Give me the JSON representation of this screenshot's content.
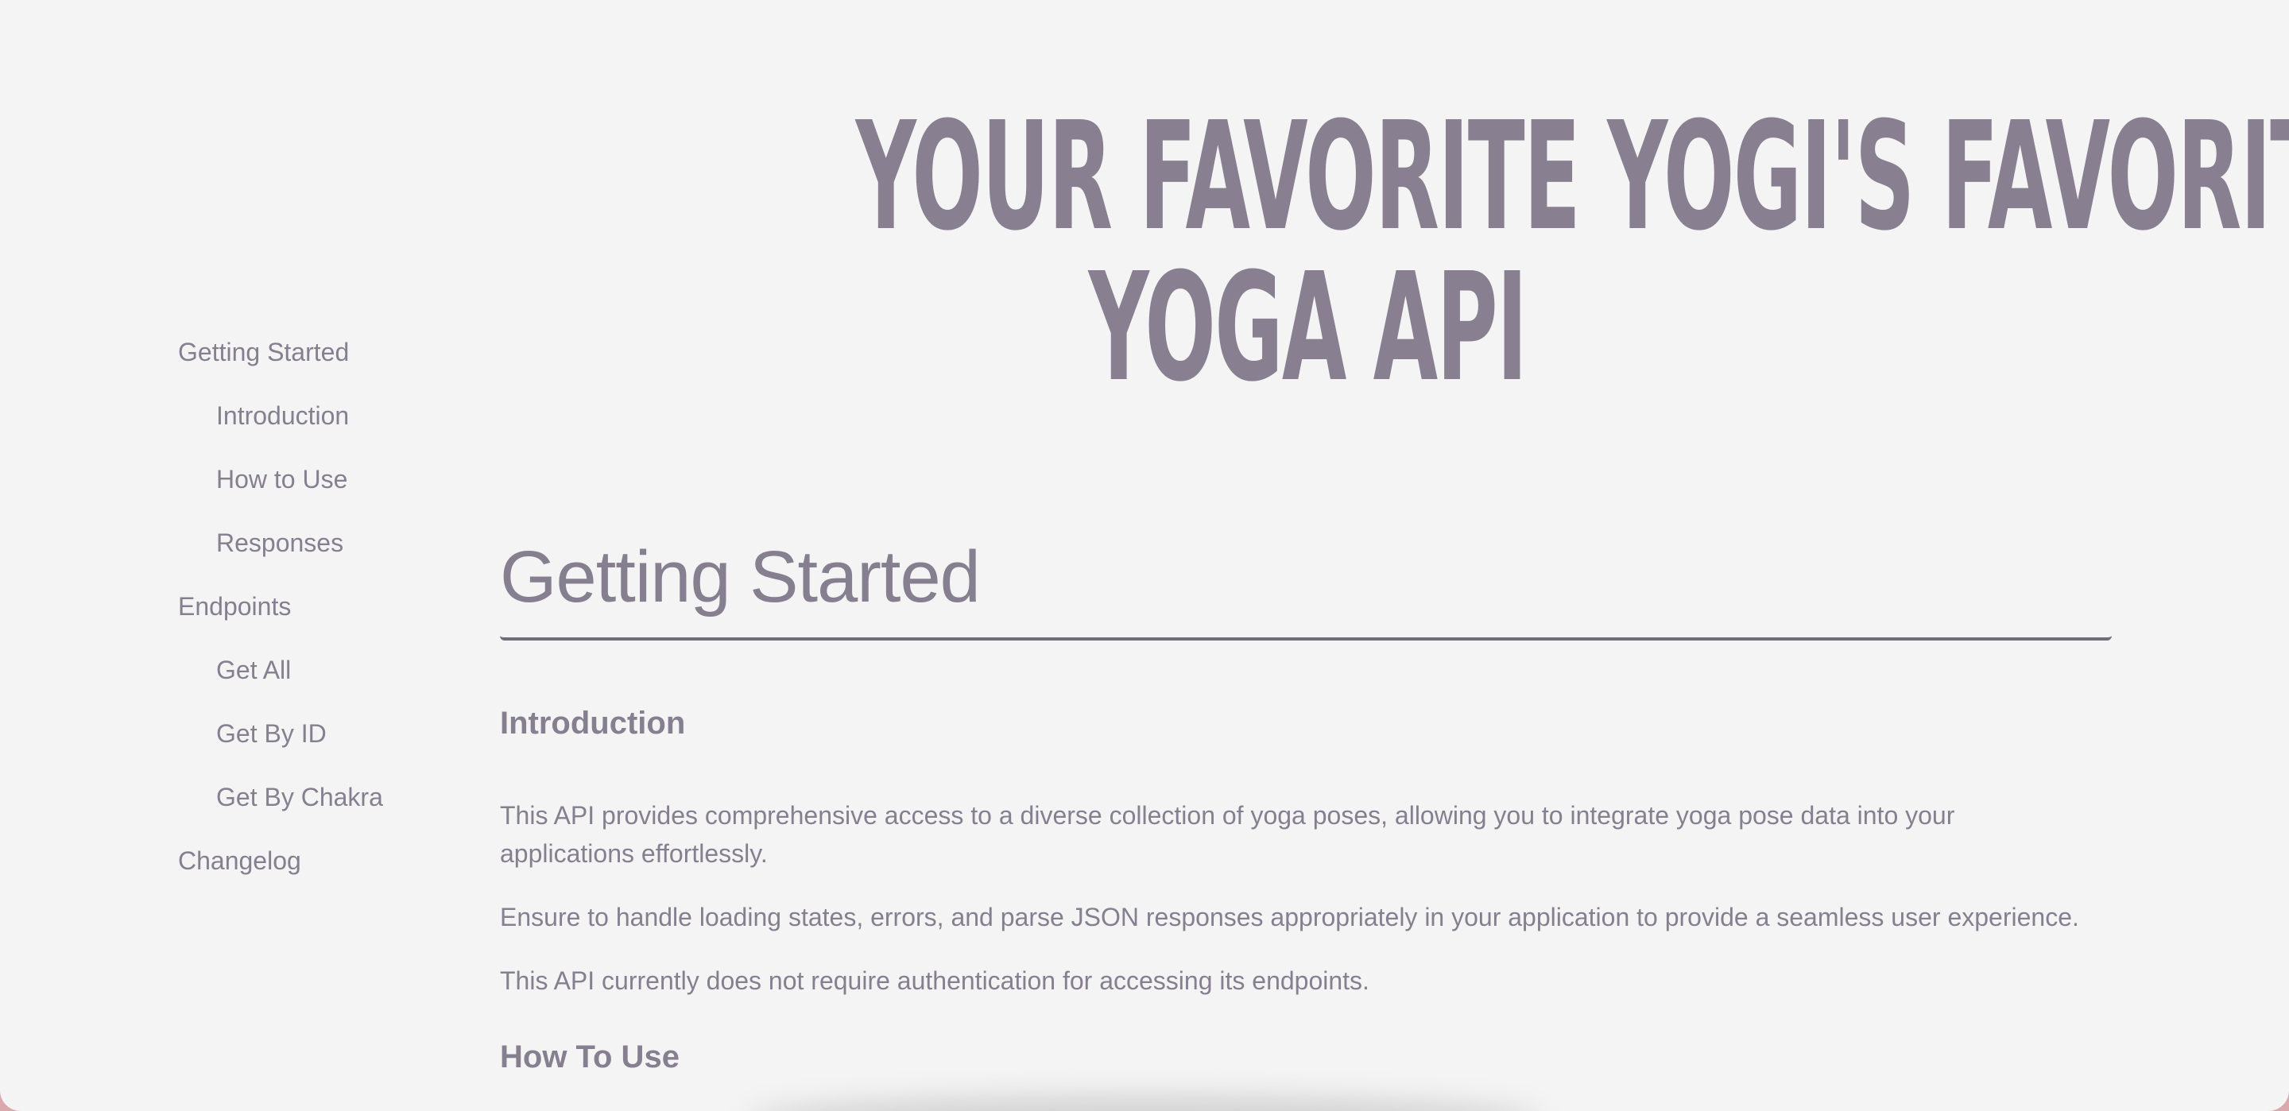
{
  "hero": {
    "line1": "YOUR FAVORITE YOGI'S FAVORITE",
    "line2": "YOGA API"
  },
  "sidebar": {
    "items": [
      {
        "label": "Getting Started",
        "level": 0
      },
      {
        "label": "Introduction",
        "level": 1
      },
      {
        "label": "How to Use",
        "level": 1
      },
      {
        "label": "Responses",
        "level": 1
      },
      {
        "label": "Endpoints",
        "level": 0
      },
      {
        "label": "Get All",
        "level": 1
      },
      {
        "label": "Get By ID",
        "level": 1
      },
      {
        "label": "Get By Chakra",
        "level": 1
      },
      {
        "label": "Changelog",
        "level": 0
      }
    ]
  },
  "main": {
    "section_title": "Getting Started",
    "introduction": {
      "heading": "Introduction",
      "paragraphs": [
        "This API provides comprehensive access to a diverse collection of yoga poses, allowing you to integrate yoga pose data into your applications effortlessly.",
        "Ensure to handle loading states, errors, and parse JSON responses appropriately in your application to provide a seamless user experience.",
        "This API currently does not require authentication for accessing its endpoints."
      ]
    },
    "how_to_use": {
      "heading": "How To Use"
    }
  },
  "colors": {
    "background": "#f4f4f4",
    "text": "#857f8f",
    "hero": "#888090",
    "rule": "#716b7a"
  }
}
